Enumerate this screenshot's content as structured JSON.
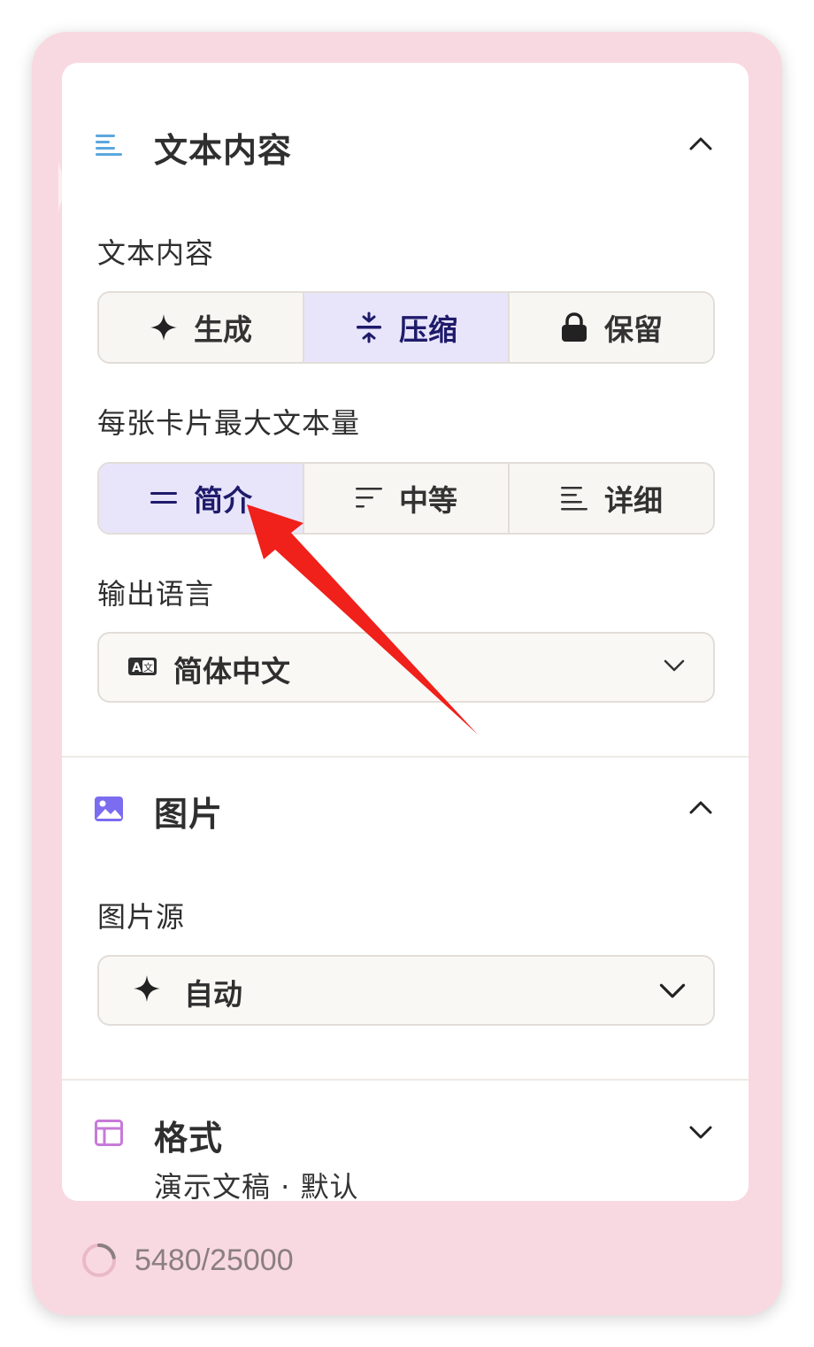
{
  "text_section": {
    "title": "文本内容",
    "icon": "text-lines-icon",
    "collapse_icon": "chevron-up-icon",
    "content_mode": {
      "label": "文本内容",
      "options": [
        {
          "label": "生成",
          "icon": "sparkle-icon",
          "active": false
        },
        {
          "label": "压缩",
          "icon": "compress-icon",
          "active": true
        },
        {
          "label": "保留",
          "icon": "lock-icon",
          "active": false
        }
      ]
    },
    "amount": {
      "label": "每张卡片最大文本量",
      "options": [
        {
          "label": "简介",
          "icon": "two-lines-icon",
          "active": true
        },
        {
          "label": "中等",
          "icon": "medium-lines-icon",
          "active": false
        },
        {
          "label": "详细",
          "icon": "detailed-lines-icon",
          "active": false
        }
      ]
    },
    "language": {
      "label": "输出语言",
      "value": "简体中文",
      "icon": "translate-icon"
    }
  },
  "image_section": {
    "title": "图片",
    "icon": "image-icon",
    "collapse_icon": "chevron-up-icon",
    "source": {
      "label": "图片源",
      "value": "自动",
      "icon": "sparkle-icon"
    }
  },
  "format_section": {
    "title": "格式",
    "subtitle": "演示文稿 · 默认",
    "icon": "layout-icon",
    "expand_icon": "chevron-down-icon"
  },
  "footer": {
    "count": "5480/25000",
    "usage_fraction": 0.22
  },
  "colors": {
    "outer_bg": "#f9d9e1",
    "active_option_bg": "#e8e5fb",
    "active_option_text": "#1f1b6b",
    "text_icon": "#5aa7de",
    "image_icon": "#7b6cf0",
    "layout_icon": "#c77ad8",
    "annotation_arrow": "#f0201a"
  }
}
